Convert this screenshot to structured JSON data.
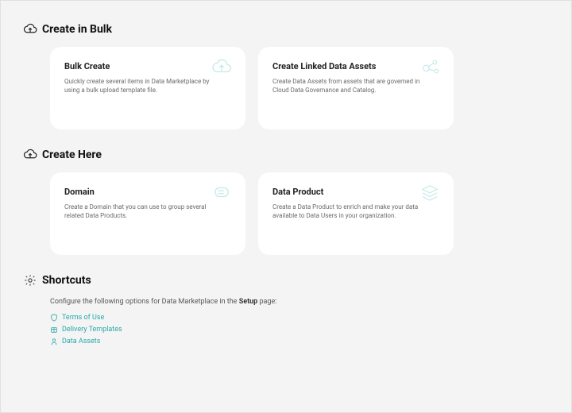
{
  "sections": {
    "create_bulk": {
      "title": "Create in Bulk",
      "cards": [
        {
          "title": "Bulk Create",
          "desc": "Quickly create several items in Data Marketplace by using a bulk upload template file."
        },
        {
          "title": "Create Linked Data Assets",
          "desc": "Create Data Assets from assets that are governed in Cloud Data Governance and Catalog."
        }
      ]
    },
    "create_here": {
      "title": "Create Here",
      "cards": [
        {
          "title": "Domain",
          "desc": "Create a Domain that you can use to group several related Data Products."
        },
        {
          "title": "Data Product",
          "desc": "Create a Data Product to enrich and make your data available to Data Users in your organization."
        }
      ]
    },
    "shortcuts": {
      "title": "Shortcuts",
      "subtitle_pre": "Configure the following options for Data Marketplace in the ",
      "subtitle_bold": "Setup",
      "subtitle_post": " page:",
      "links": [
        {
          "label": "Terms of Use"
        },
        {
          "label": "Delivery Templates"
        },
        {
          "label": "Data Assets"
        }
      ]
    }
  },
  "colors": {
    "teal": "#2aa7a7",
    "light_teal": "#8bd3d3"
  }
}
